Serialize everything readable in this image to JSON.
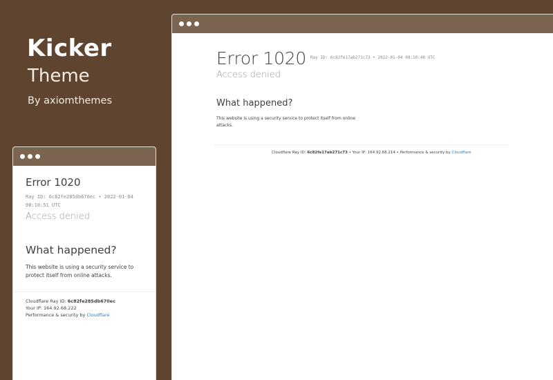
{
  "brand": {
    "title": "Kicker",
    "subtitle": "Theme",
    "byline": "By axiomthemes"
  },
  "colors": {
    "background": "#5f4530",
    "window_bar": "#7b6551",
    "link": "#2f7bbf"
  },
  "desktop": {
    "error_title": "Error 1020",
    "ray_line": "Ray ID: 6c82fe17ab271c73 • 2022-01-04 08:10:48 UTC",
    "access_denied": "Access denied",
    "what_happened": "What happened?",
    "description": "This website is using a security service to protect itself from online attacks.",
    "footer": {
      "ray_label": "Cloudflare Ray ID:",
      "ray_id": "6c82fe17ab271c73",
      "ip_label": "• Your IP: 164.92.68.214 •",
      "perf_label": "Performance & security by",
      "cloudflare_link": "Cloudflare"
    }
  },
  "mobile": {
    "error_title": "Error 1020",
    "ray_line": "Ray ID: 6c82fe285db670ec • 2022-01-04 08:10:51 UTC",
    "access_denied": "Access denied",
    "what_happened": "What happened?",
    "description": "This website is using a security service to protect itself from online attacks.",
    "footer": {
      "ray_label": "Cloudflare Ray ID:",
      "ray_id": "6c82fe285db670ec",
      "ip_line": "Your IP: 164.92.68.222",
      "perf_label": "Performance & security by",
      "cloudflare_link": "Cloudflare"
    }
  }
}
